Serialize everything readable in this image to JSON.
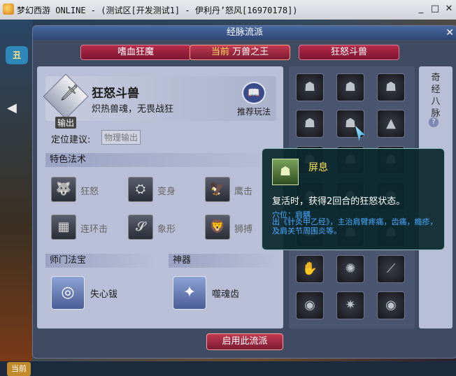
{
  "window": {
    "title": "梦幻西游 ONLINE - (测试区[开发测试1] - 伊利丹’怒风[16970178])",
    "minimize": "_",
    "maximize": "□",
    "close": "✕"
  },
  "game_hud": {
    "left_badge": "丑",
    "current_badge": "当前"
  },
  "dialog": {
    "title": "经脉流派",
    "close": "✕",
    "tabs": [
      {
        "label": "嗜血狂魔"
      },
      {
        "prefix": "当前",
        "label": "万兽之王"
      },
      {
        "label": "狂怒斗兽"
      }
    ],
    "school": {
      "role_label": "输出",
      "name": "狂怒斗兽",
      "desc": "炽热兽魂，无畏战狂",
      "recommend_label": "推荐玩法"
    },
    "positioning": {
      "label": "定位建议:",
      "tag": "物理输出"
    },
    "special_skills_title": "特色法术",
    "skills": [
      {
        "label": "狂怒",
        "icon": "beast-head-icon"
      },
      {
        "label": "变身",
        "icon": "transform-icon"
      },
      {
        "label": "鹰击",
        "icon": "eagle-icon"
      },
      {
        "label": "连环击",
        "icon": "chain-strike-icon"
      },
      {
        "label": "象形",
        "icon": "elephant-icon"
      },
      {
        "label": "狮搏",
        "icon": "lion-icon"
      }
    ],
    "treasure_title": "师门法宝",
    "treasure": {
      "label": "失心钹",
      "icon": "cymbal-icon"
    },
    "artifact_title": "神器",
    "artifact": {
      "label": "噬魂齿",
      "icon": "fang-icon"
    },
    "qijing_label": "奇经八脉",
    "qijing_help": "?",
    "apply_button": "启用此流派"
  },
  "tooltip": {
    "name": "屏息",
    "desc": "复活时，获得2回合的狂怒状态。",
    "acupoint": "穴位：肩髃",
    "detail": "出《针灸甲乙经》，主治肩臂疼痛，齿痛，瘾疹，及肩关节周围炎等。"
  }
}
